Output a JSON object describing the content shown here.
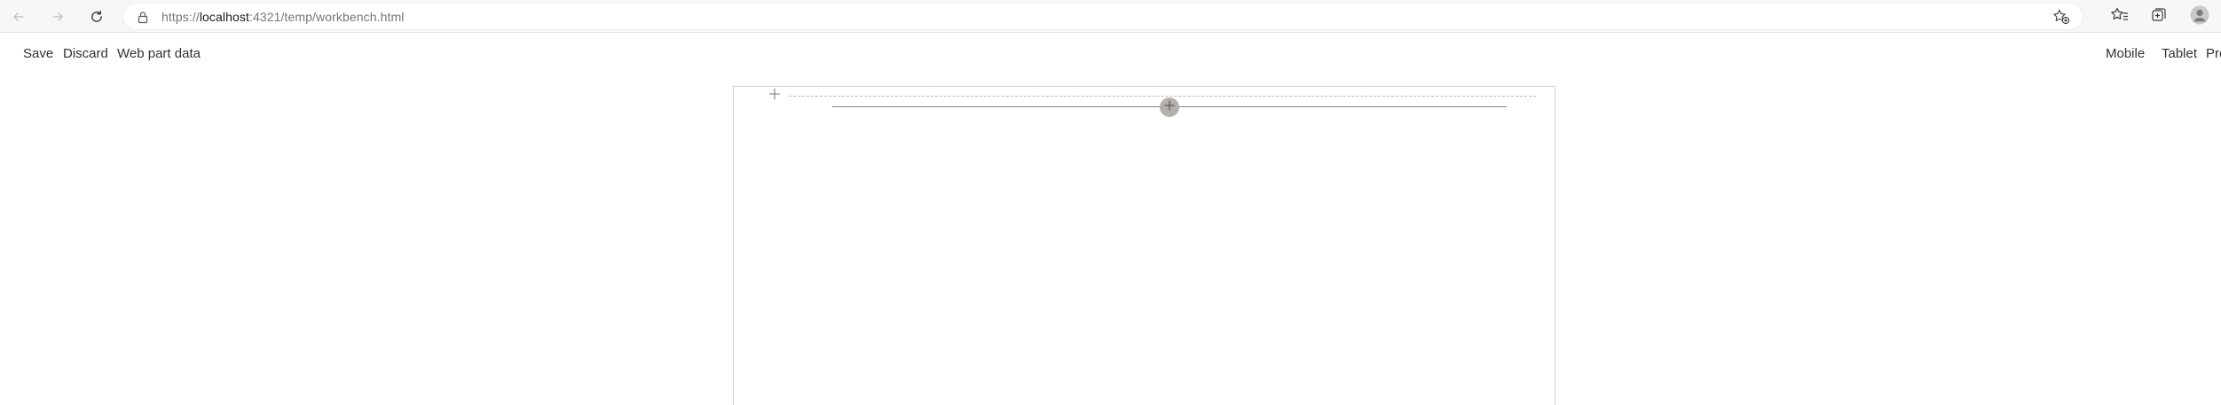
{
  "browser": {
    "url_scheme": "https://",
    "url_host": "localhost",
    "url_rest": ":4321/temp/workbench.html",
    "icons": {
      "back": "arrow-left-icon",
      "forward": "arrow-right-icon",
      "refresh": "refresh-icon",
      "lock": "lock-icon",
      "add_favorite": "star-plus-icon",
      "favorites": "favorites-icon",
      "collections": "collections-icon",
      "profile": "profile-icon"
    }
  },
  "toolbar": {
    "save_label": "Save",
    "discard_label": "Discard",
    "web_part_data_label": "Web part data",
    "mobile_label": "Mobile",
    "tablet_label": "Tablet",
    "preview_label": "Pre"
  },
  "colors": {
    "chrome_background": "#f7f7f7",
    "toolbar_text": "#323130",
    "add_button_fill": "#b3b0ad"
  }
}
